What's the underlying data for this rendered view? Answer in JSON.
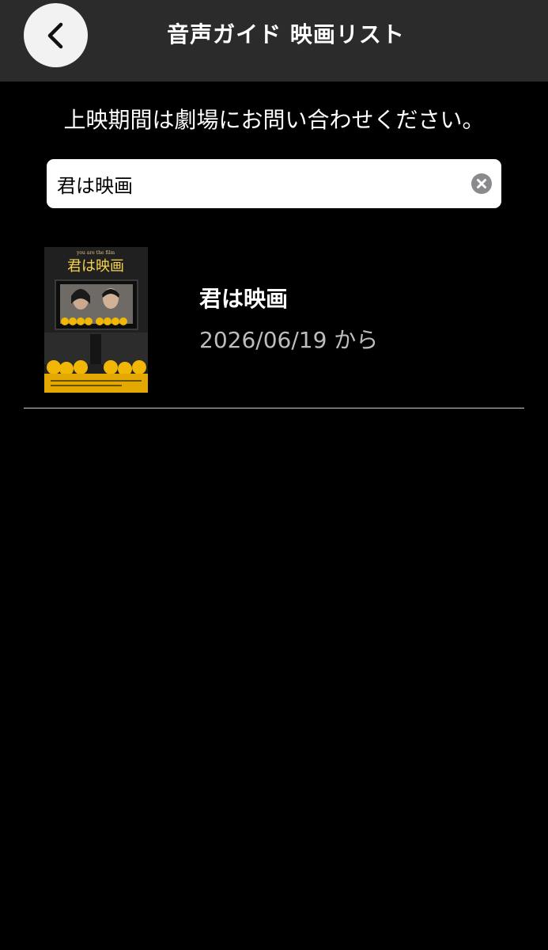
{
  "header": {
    "title": "音声ガイド 映画リスト",
    "back_icon": "chevron-left-icon"
  },
  "notice": "上映期間は劇場にお問い合わせください。",
  "search": {
    "value": "君は映画",
    "clear_icon": "clear-circle-icon"
  },
  "movies": [
    {
      "title": "君は映画",
      "date": "2026/06/19 から",
      "poster_title": "君は映画",
      "poster_subtitle": "you are the film"
    }
  ],
  "colors": {
    "background": "#000000",
    "header": "#2b2b2b",
    "date_text": "#bdbdbd",
    "poster_yellow": "#f2b705"
  }
}
